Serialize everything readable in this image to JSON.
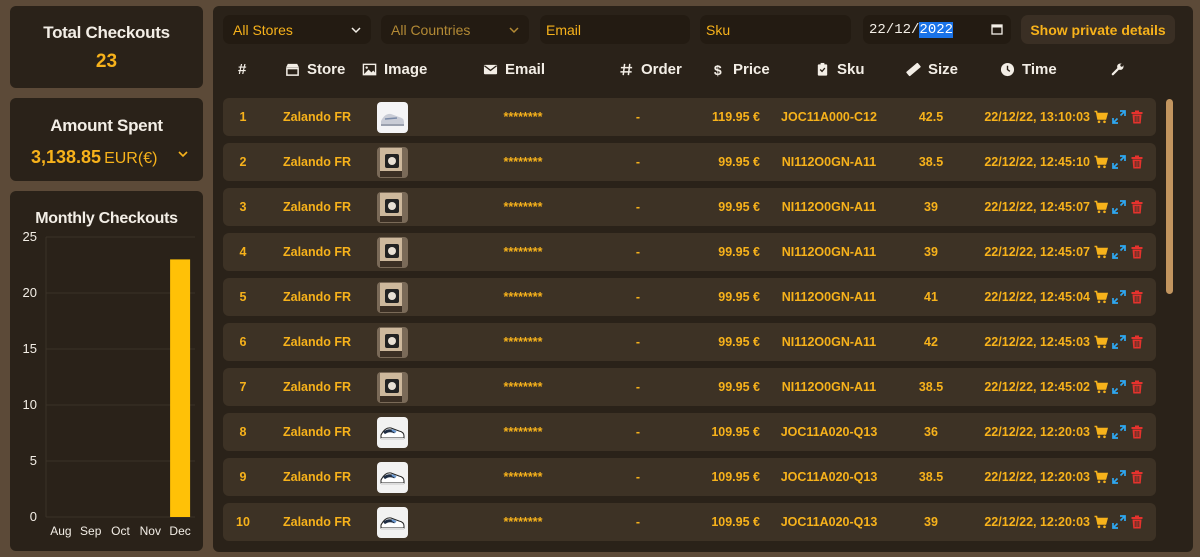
{
  "stats": {
    "total_title": "Total Checkouts",
    "total_value": "23",
    "spent_title": "Amount Spent",
    "spent_value": "3,138.85",
    "spent_currency": "EUR(€)"
  },
  "chart_data": {
    "type": "bar",
    "title": "Monthly Checkouts",
    "categories": [
      "Aug",
      "Sep",
      "Oct",
      "Nov",
      "Dec"
    ],
    "values": [
      0,
      0,
      0,
      0,
      23
    ],
    "ylim": [
      0,
      25
    ],
    "yticks": [
      0,
      5,
      10,
      15,
      20,
      25
    ],
    "bar_color": "#ffc107",
    "grid": true
  },
  "filters": {
    "store_select": "All Stores",
    "country_select": "All Countries",
    "email_value": "Email",
    "sku_value": "Sku",
    "date_prefix": "22/12/",
    "date_year": "2022",
    "private_button": "Show private details"
  },
  "columns": {
    "num": "#",
    "store": "Store",
    "image": "Image",
    "email": "Email",
    "order": "Order",
    "price": "Price",
    "sku": "Sku",
    "size": "Size",
    "time": "Time"
  },
  "rows": [
    {
      "num": "1",
      "store": "Zalando FR",
      "email": "********",
      "order": "-",
      "price": "119.95 €",
      "sku": "JOC11A000-C12",
      "size": "42.5",
      "time": "22/12/22, 13:10:03",
      "img": "shoe-grey"
    },
    {
      "num": "2",
      "store": "Zalando FR",
      "email": "********",
      "order": "-",
      "price": "99.95 €",
      "sku": "NI112O0GN-A11",
      "size": "38.5",
      "time": "22/12/22, 12:45:10",
      "img": "box"
    },
    {
      "num": "3",
      "store": "Zalando FR",
      "email": "********",
      "order": "-",
      "price": "99.95 €",
      "sku": "NI112O0GN-A11",
      "size": "39",
      "time": "22/12/22, 12:45:07",
      "img": "box"
    },
    {
      "num": "4",
      "store": "Zalando FR",
      "email": "********",
      "order": "-",
      "price": "99.95 €",
      "sku": "NI112O0GN-A11",
      "size": "39",
      "time": "22/12/22, 12:45:07",
      "img": "box"
    },
    {
      "num": "5",
      "store": "Zalando FR",
      "email": "********",
      "order": "-",
      "price": "99.95 €",
      "sku": "NI112O0GN-A11",
      "size": "41",
      "time": "22/12/22, 12:45:04",
      "img": "box"
    },
    {
      "num": "6",
      "store": "Zalando FR",
      "email": "********",
      "order": "-",
      "price": "99.95 €",
      "sku": "NI112O0GN-A11",
      "size": "42",
      "time": "22/12/22, 12:45:03",
      "img": "box"
    },
    {
      "num": "7",
      "store": "Zalando FR",
      "email": "********",
      "order": "-",
      "price": "99.95 €",
      "sku": "NI112O0GN-A11",
      "size": "38.5",
      "time": "22/12/22, 12:45:02",
      "img": "box"
    },
    {
      "num": "8",
      "store": "Zalando FR",
      "email": "********",
      "order": "-",
      "price": "109.95 €",
      "sku": "JOC11A020-Q13",
      "size": "36",
      "time": "22/12/22, 12:20:03",
      "img": "shoe-blue"
    },
    {
      "num": "9",
      "store": "Zalando FR",
      "email": "********",
      "order": "-",
      "price": "109.95 €",
      "sku": "JOC11A020-Q13",
      "size": "38.5",
      "time": "22/12/22, 12:20:03",
      "img": "shoe-blue"
    },
    {
      "num": "10",
      "store": "Zalando FR",
      "email": "********",
      "order": "-",
      "price": "109.95 €",
      "sku": "JOC11A020-Q13",
      "size": "39",
      "time": "22/12/22, 12:20:03",
      "img": "shoe-blue"
    }
  ],
  "icons": {
    "store_col": "store-icon",
    "image_col": "image-icon",
    "email_col": "envelope-icon",
    "order_col": "hash-icon",
    "price_col": "dollar-icon",
    "sku_col": "clipboard-icon",
    "size_col": "ruler-icon",
    "time_col": "clock-icon",
    "actions_col": "wrench-icon",
    "row_actions": [
      "cart-icon",
      "expand-icon",
      "trash-icon"
    ]
  },
  "colors": {
    "accent": "#f7b21b",
    "expand": "#2ea8f2",
    "trash": "#e5322d"
  }
}
